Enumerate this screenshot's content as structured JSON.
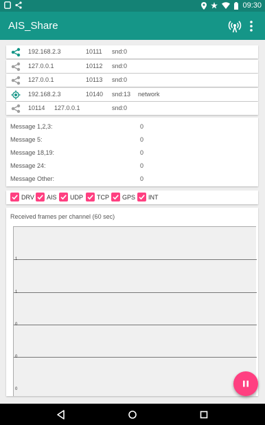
{
  "status_bar": {
    "time": "09:30",
    "icons": [
      "notification-icon",
      "share-icon",
      "location-icon",
      "star-icon",
      "wifi-icon",
      "battery-icon"
    ]
  },
  "app_bar": {
    "title": "AIS_Share",
    "icons": [
      "antenna-icon",
      "overflow-menu-icon"
    ]
  },
  "connections": [
    {
      "icon": "share-icon",
      "active": true,
      "address": "192.168.2.3",
      "port": "10111",
      "send": "snd:0",
      "extra": ""
    },
    {
      "icon": "share-icon",
      "active": false,
      "address": "127.0.0.1",
      "port": "10112",
      "send": "snd:0",
      "extra": ""
    },
    {
      "icon": "share-icon",
      "active": false,
      "address": "127.0.0.1",
      "port": "10113",
      "send": "snd:0",
      "extra": ""
    },
    {
      "icon": "gps-target-icon",
      "active": true,
      "address": "192.168.2.3",
      "port": "10140",
      "send": "snd:13",
      "extra": "network"
    },
    {
      "icon": "share-icon",
      "active": false,
      "address": "10114",
      "port": "127.0.0.1",
      "send": "snd:0",
      "extra": ""
    }
  ],
  "message_stats": [
    {
      "label": "Message 1,2,3:",
      "value": "0"
    },
    {
      "label": "Message 5:",
      "value": "0"
    },
    {
      "label": "Message 18,19:",
      "value": "0"
    },
    {
      "label": "Message 24:",
      "value": "0"
    },
    {
      "label": "Message Other:",
      "value": "0"
    }
  ],
  "filters": [
    {
      "label": "DRV",
      "checked": true
    },
    {
      "label": "AIS",
      "checked": true
    },
    {
      "label": "UDP",
      "checked": true
    },
    {
      "label": "TCP",
      "checked": true
    },
    {
      "label": "GPS",
      "checked": true
    },
    {
      "label": "INT",
      "checked": true
    }
  ],
  "colors": {
    "primary": "#159688",
    "primary_dark": "#148275",
    "accent": "#ff4081"
  },
  "chart_data": {
    "type": "line",
    "title": "Received frames per channel (60 sec)",
    "series": [],
    "y_tick_labels": [
      "1",
      "1",
      "0",
      "0",
      "0"
    ],
    "grid": true
  },
  "fab": {
    "icon": "pause-icon"
  },
  "nav_bar": {
    "icons": [
      "back-icon",
      "home-icon",
      "recents-icon"
    ]
  }
}
